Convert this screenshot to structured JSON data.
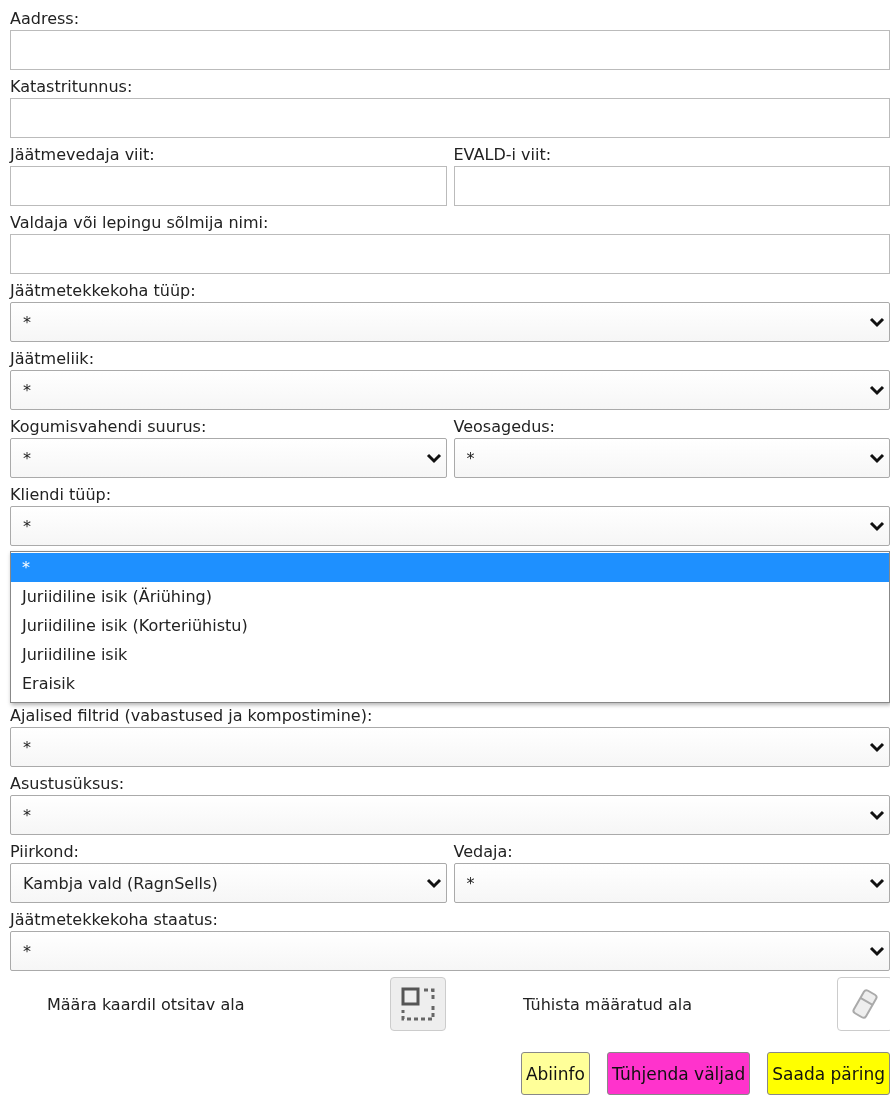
{
  "rows": [
    {
      "fields": [
        {
          "kind": "text",
          "label": "Aadress:"
        }
      ]
    },
    {
      "fields": [
        {
          "kind": "text",
          "label": "Katastritunnus:"
        }
      ]
    },
    {
      "fields": [
        {
          "kind": "text",
          "label": "Jäätmevedaja viit:"
        },
        {
          "kind": "text",
          "label": "EVALD-i viit:"
        }
      ]
    },
    {
      "fields": [
        {
          "kind": "text",
          "label": "Valdaja või lepingu sõlmija nimi:"
        }
      ]
    },
    {
      "fields": [
        {
          "kind": "select",
          "label": "Jäätmetekkekoha tüüp:",
          "value": "*"
        }
      ]
    },
    {
      "fields": [
        {
          "kind": "select",
          "label": "Jäätmeliik:",
          "value": "*"
        }
      ]
    },
    {
      "fields": [
        {
          "kind": "select",
          "label": "Kogumisvahendi suurus:",
          "value": "*"
        },
        {
          "kind": "select",
          "label": "Veosagedus:",
          "value": "*"
        }
      ]
    },
    {
      "fields": [
        {
          "kind": "select",
          "label": "Kliendi tüüp:",
          "value": "*",
          "open": true,
          "options": [
            {
              "label": "*",
              "selected": true
            },
            {
              "label": "Juriidiline isik (Äriühing)",
              "selected": false
            },
            {
              "label": "Juriidiline isik (Korteriühistu)",
              "selected": false
            },
            {
              "label": "Juriidiline isik",
              "selected": false
            },
            {
              "label": "Eraisik",
              "selected": false
            }
          ]
        }
      ]
    },
    {
      "fields": [
        {
          "kind": "select",
          "label": "Ajalised filtrid (vabastused ja kompostimine):",
          "value": "*"
        }
      ]
    },
    {
      "fields": [
        {
          "kind": "select",
          "label": "Asustusüksus:",
          "value": "*"
        }
      ]
    },
    {
      "fields": [
        {
          "kind": "select",
          "label": "Piirkond:",
          "value": "Kambja vald (RagnSells)"
        },
        {
          "kind": "select",
          "label": "Vedaja:",
          "value": "*"
        }
      ]
    },
    {
      "fields": [
        {
          "kind": "select",
          "label": "Jäätmetekkekoha staatus:",
          "value": "*"
        }
      ]
    }
  ],
  "map_tools": [
    {
      "kind": "select-area",
      "label": "Määra kaardil otsitav ala"
    },
    {
      "kind": "clear-area",
      "label": "Tühista määratud ala"
    }
  ],
  "buttons": [
    {
      "label": "Abiinfo",
      "color": "#ffff99"
    },
    {
      "label": "Tühjenda väljad",
      "color": "#ff33cc"
    },
    {
      "label": "Saada päring",
      "color": "#ffff00"
    }
  ]
}
